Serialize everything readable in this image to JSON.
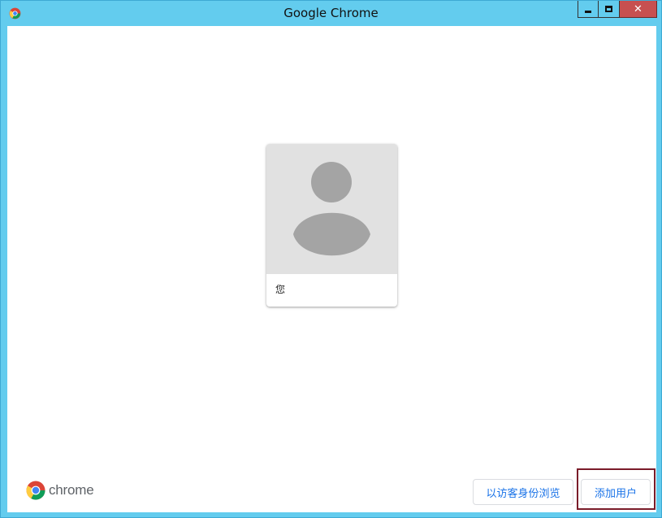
{
  "window": {
    "title": "Google Chrome",
    "controls": {
      "minimize": "minimize",
      "maximize": "maximize",
      "close": "✕"
    },
    "close_color": "#c75050",
    "frame_color": "#63ccee"
  },
  "profile": {
    "name": "您",
    "avatar_icon": "default-avatar-icon"
  },
  "brand": {
    "wordmark": "chrome",
    "logo_icon": "chrome-logo-icon"
  },
  "footer": {
    "guest_button": "以访客身份浏览",
    "add_user_button": "添加用户"
  },
  "colors": {
    "accent": "#1a73e8",
    "focus": "#7a1c2a"
  }
}
